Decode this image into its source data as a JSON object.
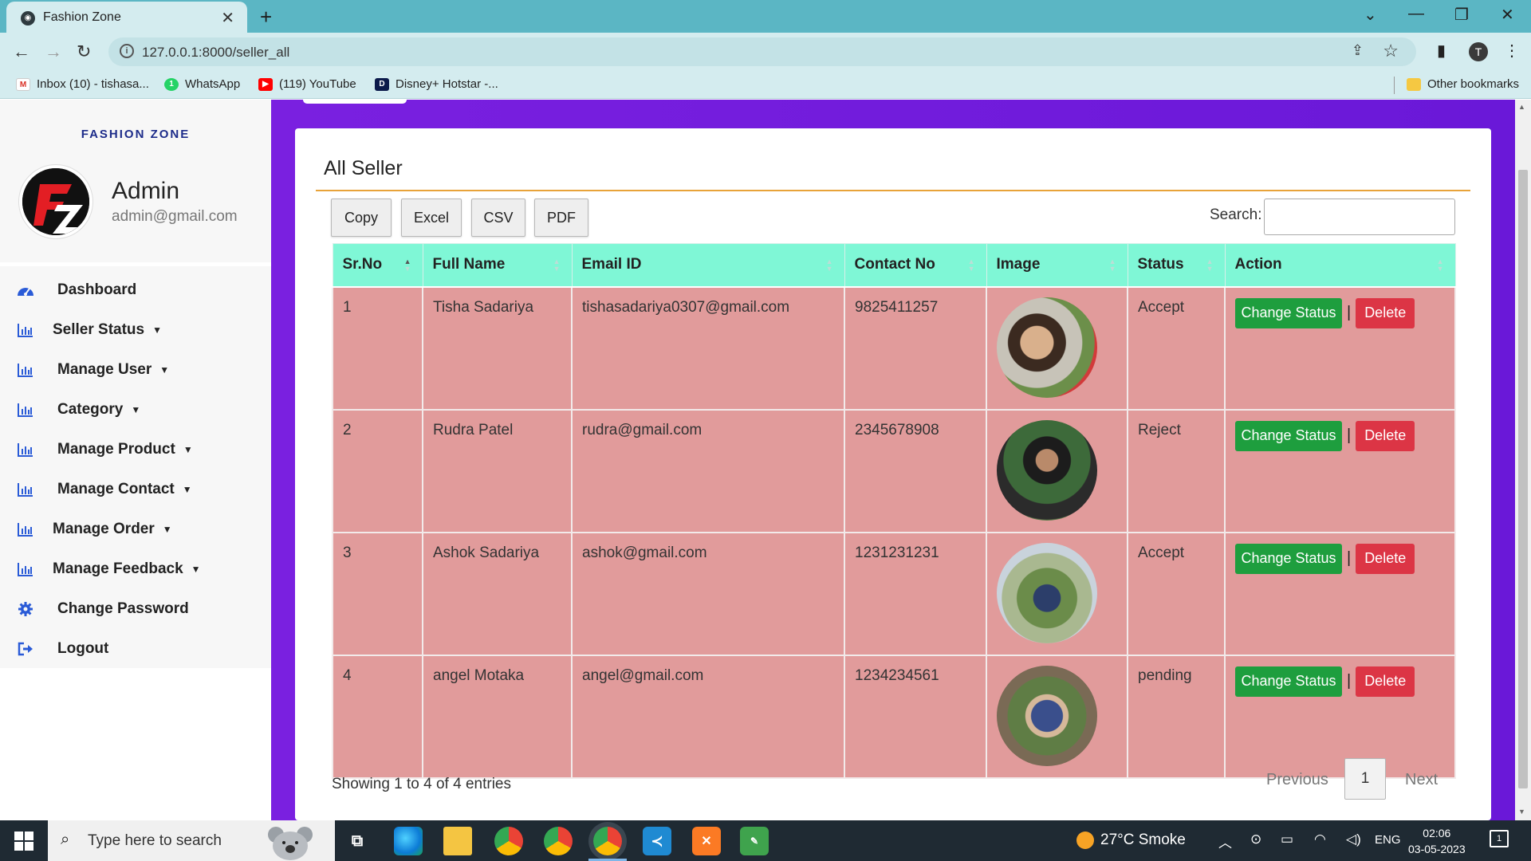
{
  "browser": {
    "tab_title": "Fashion Zone",
    "url": "127.0.0.1:8000/seller_all",
    "bookmarks": [
      {
        "label": "Inbox (10) - tishasa...",
        "icon": "gmail-icon"
      },
      {
        "label": "WhatsApp",
        "icon": "whatsapp-icon"
      },
      {
        "label": "(119) YouTube",
        "icon": "youtube-icon"
      },
      {
        "label": "Disney+ Hotstar -...",
        "icon": "hotstar-icon"
      }
    ],
    "other_bookmarks": "Other bookmarks",
    "profile_initial": "T"
  },
  "sidebar": {
    "brand": "FASHION ZONE",
    "admin_name": "Admin",
    "admin_email": "admin@gmail.com",
    "items": [
      {
        "label": "Dashboard",
        "icon": "dashboard-icon",
        "dropdown": false
      },
      {
        "label": "Seller Status",
        "icon": "bar-chart-icon",
        "dropdown": true
      },
      {
        "label": "Manage User",
        "icon": "bar-chart-icon",
        "dropdown": true
      },
      {
        "label": "Category",
        "icon": "bar-chart-icon",
        "dropdown": true
      },
      {
        "label": "Manage Product",
        "icon": "bar-chart-icon",
        "dropdown": true
      },
      {
        "label": "Manage Contact",
        "icon": "bar-chart-icon",
        "dropdown": true
      },
      {
        "label": "Manage Order",
        "icon": "bar-chart-icon",
        "dropdown": true
      },
      {
        "label": "Manage Feedback",
        "icon": "bar-chart-icon",
        "dropdown": true
      },
      {
        "label": "Change Password",
        "icon": "gear-icon",
        "dropdown": false
      },
      {
        "label": "Logout",
        "icon": "logout-icon",
        "dropdown": false
      }
    ]
  },
  "main": {
    "title": "All Seller",
    "export_buttons": [
      "Copy",
      "Excel",
      "CSV",
      "PDF"
    ],
    "search_label": "Search:",
    "search_value": "",
    "columns": [
      "Sr.No",
      "Full Name",
      "Email ID",
      "Contact No",
      "Image",
      "Status",
      "Action"
    ],
    "rows": [
      {
        "srno": "1",
        "name": "Tisha Sadariya",
        "email": "tishasadariya0307@gmail.com",
        "contact": "9825411257",
        "status": "Accept"
      },
      {
        "srno": "2",
        "name": "Rudra Patel",
        "email": "rudra@gmail.com",
        "contact": "2345678908",
        "status": "Reject"
      },
      {
        "srno": "3",
        "name": "Ashok Sadariya",
        "email": "ashok@gmail.com",
        "contact": "1231231231",
        "status": "Accept"
      },
      {
        "srno": "4",
        "name": "angel Motaka",
        "email": "angel@gmail.com",
        "contact": "1234234561",
        "status": "pending"
      }
    ],
    "change_status_label": "Change Status",
    "delete_label": "Delete",
    "info": "Showing 1 to 4 of 4 entries",
    "pager": {
      "previous": "Previous",
      "current": "1",
      "next": "Next"
    }
  },
  "taskbar": {
    "search_placeholder": "Type here to search",
    "weather": "27°C  Smoke",
    "lang": "ENG",
    "time": "02:06",
    "date": "03-05-2023",
    "notifications": "1"
  },
  "colors": {
    "purple": "#7a20e0",
    "header_mint": "#7ff7d6",
    "row_pink": "#e19b9b",
    "success": "#1e9e3e",
    "danger": "#dc3545",
    "accent_line": "#e8a33a"
  }
}
